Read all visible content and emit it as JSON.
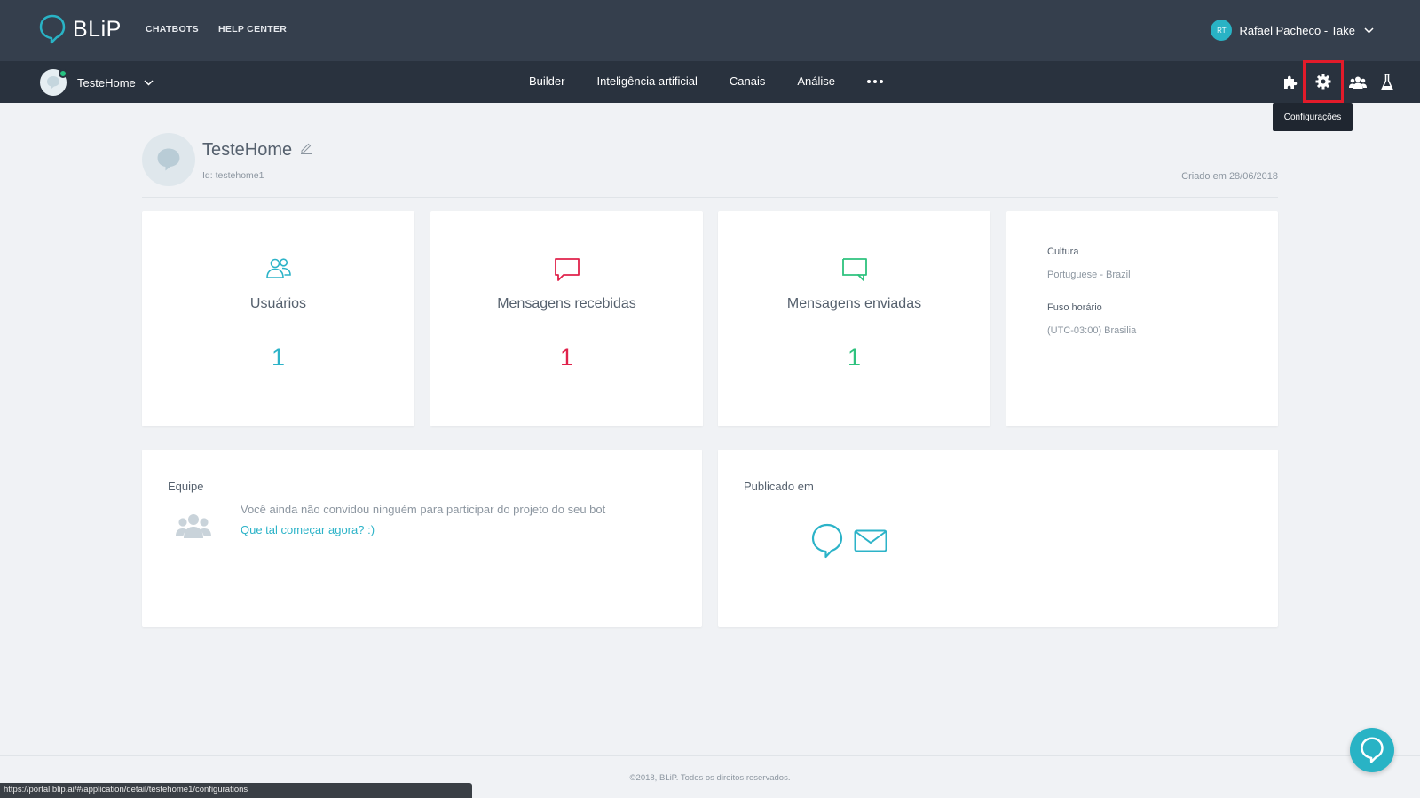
{
  "topbar": {
    "logo_text": "BLiP",
    "nav": [
      "CHATBOTS",
      "HELP CENTER"
    ],
    "user_initials": "RT",
    "user_name": "Rafael Pacheco - Take"
  },
  "subbar": {
    "bot_name": "TesteHome",
    "nav": [
      "Builder",
      "Inteligência artificial",
      "Canais",
      "Análise"
    ],
    "tools": [
      "puzzle-icon",
      "gear-icon",
      "team-icon",
      "flask-icon"
    ],
    "tooltip": "Configurações"
  },
  "header": {
    "bot_title": "TesteHome",
    "bot_id": "Id: testehome1",
    "created": "Criado em  28/06/2018"
  },
  "stats": [
    {
      "label": "Usuários",
      "value": "1",
      "color": "#2cb3c8",
      "icon": "users-icon"
    },
    {
      "label": "Mensagens recebidas",
      "value": "1",
      "color": "#e0224b",
      "icon": "chat-received-icon"
    },
    {
      "label": "Mensagens enviadas",
      "value": "1",
      "color": "#2ec27e",
      "icon": "chat-sent-icon"
    }
  ],
  "info": {
    "culture_label": "Cultura",
    "culture_value": "Portuguese - Brazil",
    "tz_label": "Fuso horário",
    "tz_value": "(UTC-03:00) Brasilia"
  },
  "team": {
    "title": "Equipe",
    "message": "Você ainda não convidou ninguém para participar do projeto do seu bot",
    "link": "Que tal começar agora? :)"
  },
  "published": {
    "title": "Publicado em",
    "channels": [
      "blip-chat-icon",
      "email-icon"
    ]
  },
  "footer": {
    "copyright": "©2018, BLiP. Todos os direitos reservados.",
    "status_url": "https://portal.blip.ai/#/application/detail/testehome1/configurations"
  },
  "colors": {
    "topbar": "#353f4d",
    "subbar": "#29323e",
    "accent": "#2cb3c8",
    "highlight": "#e21b2a"
  }
}
